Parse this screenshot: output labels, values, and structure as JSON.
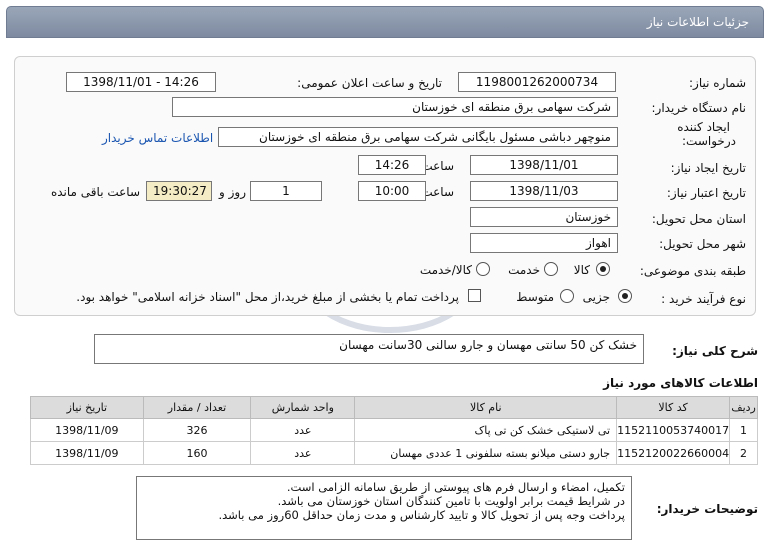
{
  "window": {
    "title": "جزئیات اطلاعات نیاز"
  },
  "form": {
    "need_number_label": "شماره نیاز:",
    "need_number": "1198001262000734",
    "announce_label": "تاریخ و ساعت اعلان عمومی:",
    "announce_value": "1398/11/01 - 14:26",
    "buyer_org_label": "نام دستگاه خریدار:",
    "buyer_org": "شرکت سهامی برق منطقه ای خوزستان",
    "requester_label_1": "ایجاد کننده",
    "requester_label_2": "درخواست:",
    "requester": "منوچهر دباشی مسئول بایگانی شرکت سهامی برق منطقه ای خوزستان",
    "contact_link": "اطلاعات تماس خریدار",
    "created_label": "تاریخ ایجاد نیاز:",
    "created_date": "1398/11/01",
    "time_label": "ساعت",
    "created_time": "14:26",
    "validity_label": "تاریخ اعتبار نیاز:",
    "validity_date": "1398/11/03",
    "validity_time": "10:00",
    "days": "1",
    "days_label": "روز و",
    "remaining_time": "19:30:27",
    "remaining_label": "ساعت باقی مانده",
    "province_label": "استان محل تحویل:",
    "province": "خوزستان",
    "city_label": "شهر محل تحویل:",
    "city": "اهواز",
    "category_label": "طبقه بندی موضوعی:",
    "category_options": [
      "کالا",
      "خدمت",
      "کالا/خدمت"
    ],
    "process_label": "نوع فرآیند خرید :",
    "process_options": [
      "جزیی",
      "متوسط"
    ],
    "payment_note": "پرداخت تمام یا بخشی از مبلغ خرید،از محل \"اسناد خزانه اسلامی\" خواهد بود."
  },
  "summary": {
    "label": "شرح کلی نیاز:",
    "text": "خشک کن 50 سانتی مهسان و جارو سالنی 30سانت مهسان"
  },
  "items": {
    "section_title": "اطلاعات کالاهای مورد نیاز",
    "columns": [
      "ردیف",
      "کد کالا",
      "نام کالا",
      "واحد شمارش",
      "تعداد / مقدار",
      "تاریخ نیاز"
    ],
    "rows": [
      [
        "1",
        "1152110053740017",
        "تی لاستیکی خشک کن تی پاک",
        "عدد",
        "326",
        "1398/11/09"
      ],
      [
        "2",
        "1152120022660004",
        "جارو دستی میلانو بسته سلفونی 1 عددی مهسان",
        "عدد",
        "160",
        "1398/11/09"
      ]
    ]
  },
  "buyer_notes": {
    "label": "توضیحات خریدار:",
    "lines": [
      "تکمیل، امضاء و ارسال فرم های پیوستی از طریق سامانه الزامی است.",
      "در شرایط  قیمت برابر اولویت با تامین کنندگان استان خوزستان می باشد.",
      "پرداخت وجه پس از تحویل کالا و تایید کارشناس و مدت زمان حداقل 60روز می باشد."
    ]
  },
  "colors": {
    "title_bar": "#8a96aa",
    "link": "#1a55b0",
    "remaining_bg": "#f4ecc4"
  }
}
